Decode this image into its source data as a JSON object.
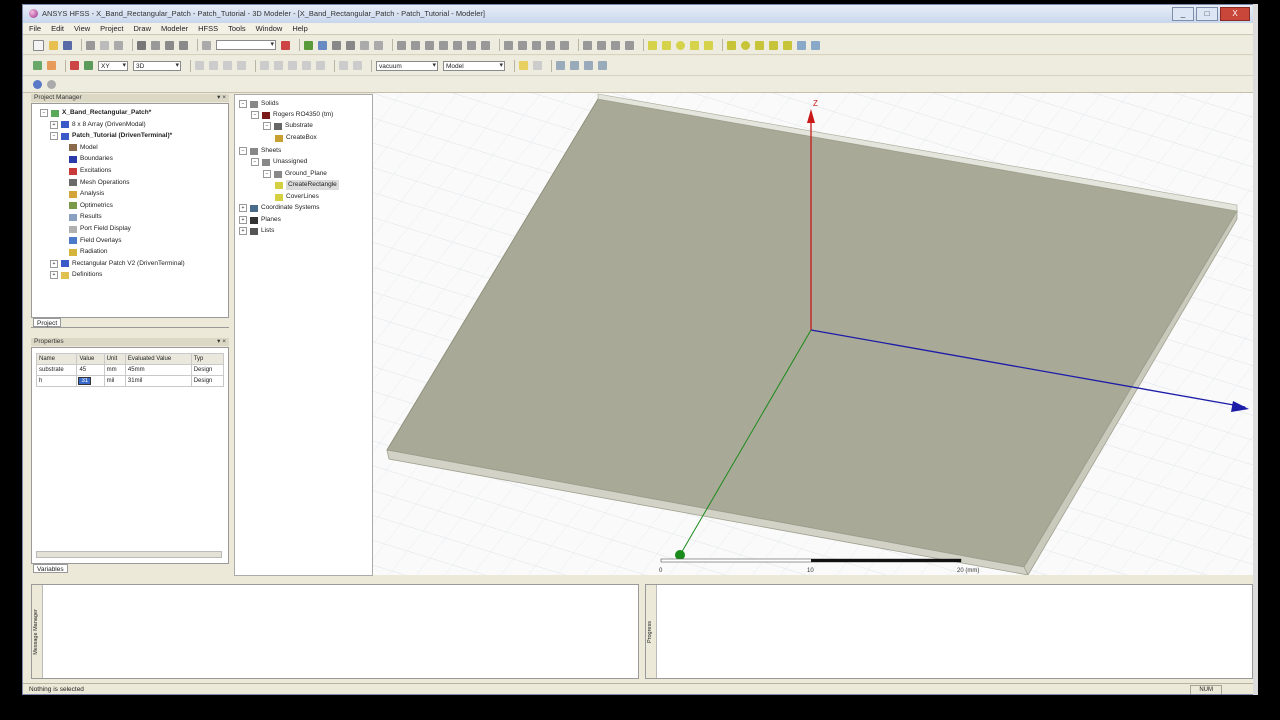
{
  "window": {
    "title": "ANSYS HFSS - X_Band_Rectangular_Patch - Patch_Tutorial - 3D Modeler - [X_Band_Rectangular_Patch - Patch_Tutorial - Modeler]",
    "buttons": [
      "_",
      "□",
      "X"
    ]
  },
  "menu": [
    "File",
    "Edit",
    "View",
    "Project",
    "Draw",
    "Modeler",
    "HFSS",
    "Tools",
    "Window",
    "Help"
  ],
  "toolbar": {
    "plane_combo": "XY",
    "dim_combo": "3D",
    "material_combo": "vacuum",
    "mode_combo": "Model"
  },
  "project_manager": {
    "header": "Project Manager",
    "tree": [
      {
        "label": "X_Band_Rectangular_Patch*",
        "depth": 0,
        "icon": "project-icon",
        "bold": true
      },
      {
        "label": "8 x 8 Array (DrivenModal)",
        "depth": 1,
        "icon": "design-icon"
      },
      {
        "label": "Patch_Tutorial (DrivenTerminal)*",
        "depth": 1,
        "icon": "design-icon",
        "bold": true
      },
      {
        "label": "Model",
        "depth": 2,
        "icon": "model-icon"
      },
      {
        "label": "Boundaries",
        "depth": 2,
        "icon": "boundaries-icon"
      },
      {
        "label": "Excitations",
        "depth": 2,
        "icon": "excitations-icon"
      },
      {
        "label": "Mesh Operations",
        "depth": 2,
        "icon": "mesh-icon"
      },
      {
        "label": "Analysis",
        "depth": 2,
        "icon": "analysis-icon"
      },
      {
        "label": "Optimetrics",
        "depth": 2,
        "icon": "optimetrics-icon"
      },
      {
        "label": "Results",
        "depth": 2,
        "icon": "results-icon"
      },
      {
        "label": "Port Field Display",
        "depth": 2,
        "icon": "port-field-icon"
      },
      {
        "label": "Field Overlays",
        "depth": 2,
        "icon": "field-overlays-icon"
      },
      {
        "label": "Radiation",
        "depth": 2,
        "icon": "radiation-icon"
      },
      {
        "label": "Rectangular Patch V2 (DrivenTerminal)",
        "depth": 1,
        "icon": "design-icon"
      },
      {
        "label": "Definitions",
        "depth": 1,
        "icon": "folder-icon"
      }
    ],
    "tab": "Project"
  },
  "properties": {
    "header": "Properties",
    "columns": [
      "Name",
      "Value",
      "Unit",
      "Evaluated Value",
      "Typ"
    ],
    "rows": [
      [
        "substrate",
        "45",
        "mm",
        "45mm",
        "Design"
      ],
      [
        "h",
        "31",
        "mil",
        "31mil",
        "Design"
      ]
    ],
    "tab": "Variables"
  },
  "history_tree": [
    {
      "label": "Solids",
      "depth": 0
    },
    {
      "label": "Rogers RO4350 (tm)",
      "depth": 1
    },
    {
      "label": "Substrate",
      "depth": 2
    },
    {
      "label": "CreateBox",
      "depth": 3
    },
    {
      "label": "Sheets",
      "depth": 0
    },
    {
      "label": "Unassigned",
      "depth": 1
    },
    {
      "label": "Ground_Plane",
      "depth": 2
    },
    {
      "label": "CreateRectangle",
      "depth": 3,
      "selected": true
    },
    {
      "label": "CoverLines",
      "depth": 3
    },
    {
      "label": "Coordinate Systems",
      "depth": 0
    },
    {
      "label": "Planes",
      "depth": 0
    },
    {
      "label": "Lists",
      "depth": 0
    }
  ],
  "viewport": {
    "axis_z_label": "Z",
    "ruler": {
      "labels": [
        "0",
        "10",
        "20 (mm)"
      ]
    },
    "colors": {
      "substrate": "#a8a996",
      "z_axis": "#c81818",
      "x_axis": "#1c1ca8",
      "y_axis": "#1a8a1a"
    }
  },
  "bottom": {
    "message_manager": "Message Manager",
    "progress": "Progress"
  },
  "status": {
    "text": "Nothing is selected",
    "num": "NUM"
  }
}
